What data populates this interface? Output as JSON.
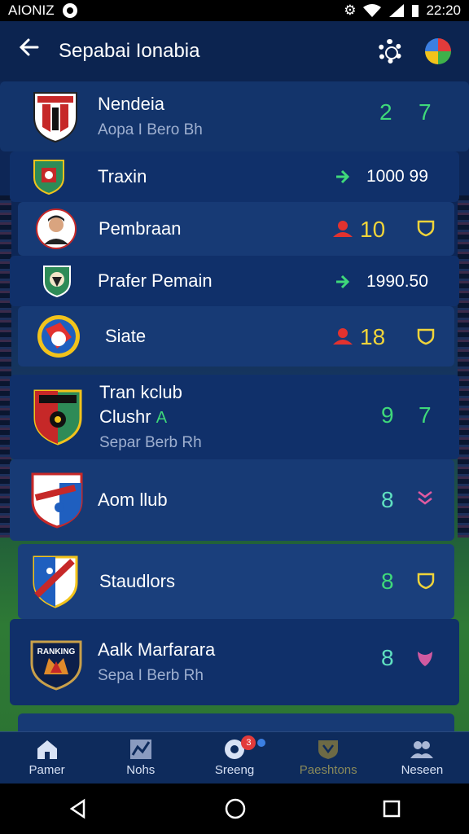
{
  "status_bar": {
    "carrier": "AIONIZ",
    "time": "22:20"
  },
  "app_bar": {
    "title": "Sepabai Ionabia",
    "back_icon": "back-arrow-icon",
    "settings_icon": "gear-icon",
    "ball_icon": "ball-icon"
  },
  "list": {
    "rows": [
      {
        "name": "Nendeia",
        "sub": "Aopa I Bero Bh",
        "values": [
          "2",
          "7"
        ]
      },
      {
        "name": "Traxin",
        "value": "1000 99"
      },
      {
        "name": "Pembraan",
        "value": "10"
      },
      {
        "name": "Prafer Pemain",
        "value": "1990.50"
      },
      {
        "name": "Siate",
        "value": "18"
      },
      {
        "name": "Tran kclub",
        "name2": "Clushr",
        "sub": "Separ Berb Rh",
        "values": [
          "9",
          "7"
        ]
      },
      {
        "name": "Aom llub",
        "value": "8"
      },
      {
        "name": "Staudlors",
        "value": "8"
      },
      {
        "name": "Aalk Marfarara",
        "sub": "Sepa I Berb Rh",
        "value": "8",
        "crest_text": "RANKING"
      }
    ]
  },
  "bottom_nav": {
    "tabs": [
      {
        "label": "Pamer",
        "icon": "home-icon"
      },
      {
        "label": "Nohs",
        "icon": "chart-icon"
      },
      {
        "label": "Sreeng",
        "icon": "ball-badge-icon",
        "badge": "3"
      },
      {
        "label": "Paeshtons",
        "icon": "shield-icon"
      },
      {
        "label": "Neseen",
        "icon": "people-icon"
      }
    ]
  },
  "colors": {
    "accent_green": "#3fd97a",
    "accent_yellow": "#f0d43a",
    "accent_red": "#e2322f",
    "background": "#0b1f4a"
  }
}
